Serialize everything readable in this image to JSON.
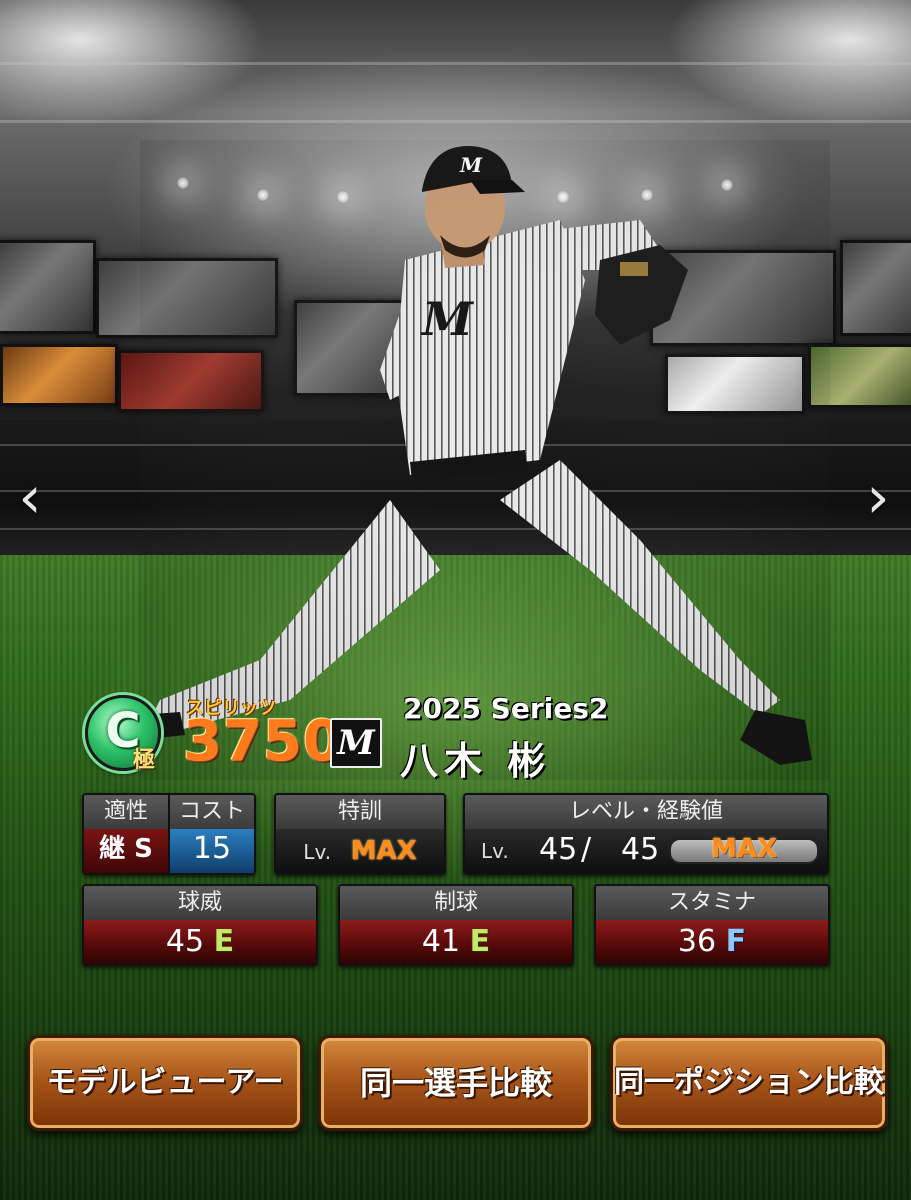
{
  "nav": {
    "prev_glyph": "‹",
    "next_glyph": "›"
  },
  "player": {
    "rank_letter": "C",
    "rank_sub": "極",
    "spirits_label": "スピリッツ",
    "spirits_value": "3750",
    "team_logo": "M",
    "series": "2025 Series2",
    "name": "八木 彬"
  },
  "stats": {
    "aptitude": {
      "label": "適性",
      "value": "継 S"
    },
    "cost": {
      "label": "コスト",
      "value": "15"
    },
    "training": {
      "label": "特訓",
      "lv_prefix": "Lv.",
      "value": "MAX"
    },
    "level": {
      "label": "レベル・経験値",
      "lv_prefix": "Lv.",
      "current": "45",
      "separator": "/",
      "max": "45",
      "bar_label": "MAX",
      "exp_progress": 1.0
    },
    "velocity": {
      "label": "球威",
      "value": "45",
      "grade": "E"
    },
    "control": {
      "label": "制球",
      "value": "41",
      "grade": "E"
    },
    "stamina": {
      "label": "スタミナ",
      "value": "36",
      "grade": "F"
    }
  },
  "buttons": {
    "model_viewer": "モデルビューアー",
    "same_player_compare": "同一選手比較",
    "same_position_compare": "同一ポジション比較"
  },
  "colors": {
    "spirits": "#ff7a1a",
    "max": "#ff8c1a",
    "grade_e": "#c6e86a",
    "grade_f": "#8fc8ff",
    "button": "#a9571a"
  }
}
